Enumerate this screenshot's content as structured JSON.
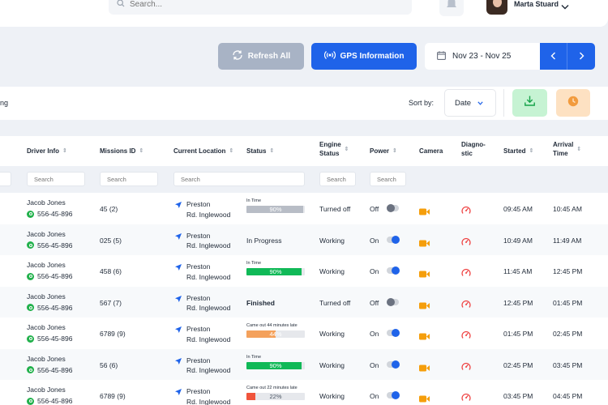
{
  "header": {
    "search_placeholder": "Search...",
    "user_name": "Marta Stuard"
  },
  "toolbar": {
    "refresh_label": "Refresh All",
    "gps_label": "GPS Information",
    "date_range": "Nov 23 - Nov 25"
  },
  "filter_bar": {
    "left_text": "ng",
    "sort_by_label": "Sort by:",
    "sort_value": "Date"
  },
  "colors": {
    "primary": "#1f63e9",
    "progress_green": "#10b957",
    "progress_orange": "#f4a15c",
    "progress_red": "#f0543c",
    "progress_gray": "#b8bdc6",
    "camera_orange": "#f59e0b",
    "whatsapp_green": "#22b14c"
  },
  "table": {
    "columns": {
      "driver": "Driver Info",
      "missions": "Missions ID",
      "location": "Current Location",
      "status": "Status",
      "engine_1": "Engine",
      "engine_2": "Status",
      "power": "Power",
      "camera": "Camera",
      "diag_1": "Diagno-",
      "diag_2": "stic",
      "started": "Started",
      "arrival_1": "Arrival",
      "arrival_2": "Time"
    },
    "filter_placeholder": "Search",
    "rows": [
      {
        "driver": "Jacob Jones",
        "phone": "556-45-896",
        "mission": "45 (2)",
        "loc1": "Preston",
        "loc2": "Rd. Inglewood",
        "status_type": "bar",
        "status_note": "In Time",
        "progress_text": "90%",
        "progress": 0.97,
        "bar_color": "gray",
        "engine": "Turned off",
        "power": "Off",
        "power_on": false,
        "started": "09:45 AM",
        "arrival": "10:45 AM"
      },
      {
        "driver": "Jacob Jones",
        "phone": "556-45-896",
        "mission": "025 (5)",
        "loc1": "Preston",
        "loc2": "Rd. Inglewood",
        "status_type": "text",
        "status_text": "In Progress",
        "bold": false,
        "engine": "Working",
        "power": "On",
        "power_on": true,
        "started": "10:49 AM",
        "arrival": "11:49 AM"
      },
      {
        "driver": "Jacob Jones",
        "phone": "556-45-896",
        "mission": "458 (6)",
        "loc1": "Preston",
        "loc2": "Rd. Inglewood",
        "status_type": "bar",
        "status_note": "In Time",
        "progress_text": "90%",
        "progress": 0.95,
        "bar_color": "green",
        "engine": "Working",
        "power": "On",
        "power_on": true,
        "started": "11:45 AM",
        "arrival": "12:45 PM"
      },
      {
        "driver": "Jacob Jones",
        "phone": "556-45-896",
        "mission": "567 (7)",
        "loc1": "Preston",
        "loc2": "Rd. Inglewood",
        "status_type": "text",
        "status_text": "Finished",
        "bold": true,
        "engine": "Turned off",
        "power": "Off",
        "power_on": false,
        "started": "12:45 PM",
        "arrival": "01:45 PM"
      },
      {
        "driver": "Jacob Jones",
        "phone": "556-45-896",
        "mission": "6789 (9)",
        "loc1": "Preston",
        "loc2": "Rd. Inglewood",
        "status_type": "bar",
        "status_note": "Came out 44 minutes late",
        "progress_text": "44%",
        "progress": 0.5,
        "bar_color": "orange",
        "engine": "Working",
        "power": "On",
        "power_on": true,
        "started": "01:45 PM",
        "arrival": "02:45 PM"
      },
      {
        "driver": "Jacob Jones",
        "phone": "556-45-896",
        "mission": "56 (6)",
        "loc1": "Preston",
        "loc2": "Rd. Inglewood",
        "status_type": "bar",
        "status_note": "In Time",
        "progress_text": "90%",
        "progress": 0.95,
        "bar_color": "green",
        "engine": "Working",
        "power": "On",
        "power_on": true,
        "started": "02:45 PM",
        "arrival": "03:45 PM"
      },
      {
        "driver": "Jacob Jones",
        "phone": "556-45-896",
        "mission": "6789 (9)",
        "loc1": "Preston",
        "loc2": "Rd. Inglewood",
        "status_type": "bar",
        "status_note": "Came out 22 minutes late",
        "progress_text": "22%",
        "progress": 0.15,
        "bar_color": "red",
        "engine": "Working",
        "power": "On",
        "power_on": true,
        "started": "03:45 PM",
        "arrival": "04:45 PM"
      }
    ]
  }
}
